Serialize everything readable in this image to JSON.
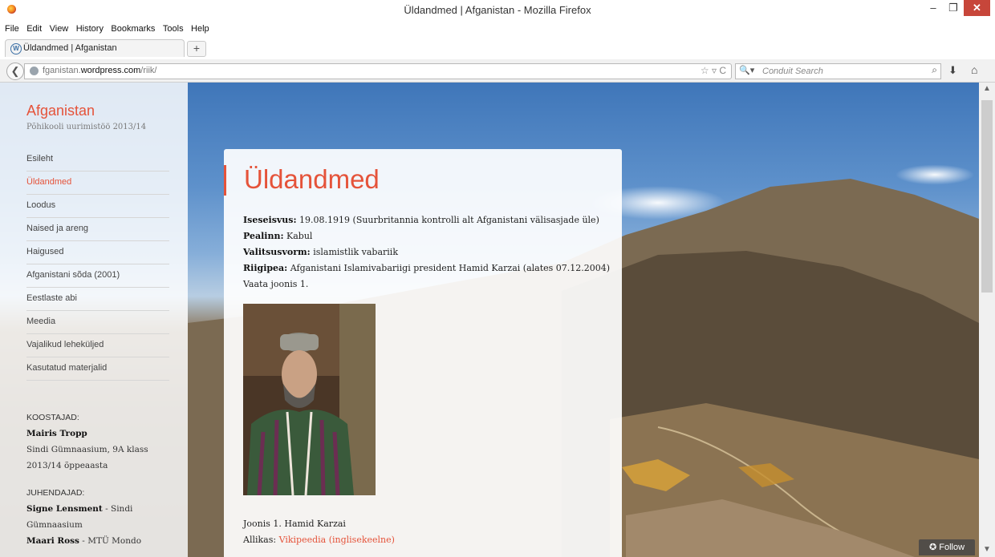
{
  "window": {
    "title": "Üldandmed | Afganistan - Mozilla Firefox",
    "minimize": "–",
    "maximize": "❐",
    "close": "✕"
  },
  "menu": [
    "File",
    "Edit",
    "View",
    "History",
    "Bookmarks",
    "Tools",
    "Help"
  ],
  "tab": {
    "label": "Üldandmed | Afganistan",
    "new_tab": "+"
  },
  "address": {
    "prefix": "fganistan.",
    "domain": "wordpress.com",
    "path": "/riik/",
    "icons": "☆ ▿ C"
  },
  "search": {
    "engine": "🔍▾",
    "placeholder": "Conduit Search",
    "go": "⌕"
  },
  "site": {
    "title": "Afganistan",
    "subtitle": "Põhikooli uurimistöö 2013/14",
    "nav": [
      "Esileht",
      "Üldandmed",
      "Loodus",
      "Naised ja areng",
      "Haigused",
      "Afganistani sõda (2001)",
      "Eestlaste abi",
      "Meedia",
      "Vajalikud leheküljed",
      "Kasutatud materjalid"
    ],
    "active_index": 1,
    "authors_caption": "KOOSTAJAD:",
    "author_name": "Mairis Tropp",
    "author_school": "Sindi Gümnaasium, 9A klass",
    "author_year": "2013/14 õppeaasta",
    "supervisors_caption": "JUHENDAJAD:",
    "supervisor1_name": "Signe Lensment",
    "supervisor1_org": " - Sindi",
    "supervisor1_org2": "Gümnaasium",
    "supervisor2_name": "Maari Ross",
    "supervisor2_org": " - MTÜ Mondo"
  },
  "article": {
    "heading": "Üldandmed",
    "facts": [
      {
        "label": "Iseseisvus:",
        "value": " 19.08.1919 (Suurbritannia kontrolli alt Afganistani välisasjade üle)"
      },
      {
        "label": "Pealinn:",
        "value": " Kabul"
      },
      {
        "label": "Valitsusvorm:",
        "value": " islamistlik vabariik"
      },
      {
        "label": "Riigipea:",
        "value": " Afganistani Islamivabariigi president Hamid Karzai (alates 07.12.2004)"
      }
    ],
    "see_figure": "Vaata joonis 1.",
    "caption": "Joonis 1. Hamid Karzai",
    "source_label": "Allikas: ",
    "source_link": "Vikipeedia (inglisekeelne)"
  },
  "follow": "✪ Follow",
  "colors": {
    "accent": "#e5533a",
    "close_button": "#c7463a"
  }
}
